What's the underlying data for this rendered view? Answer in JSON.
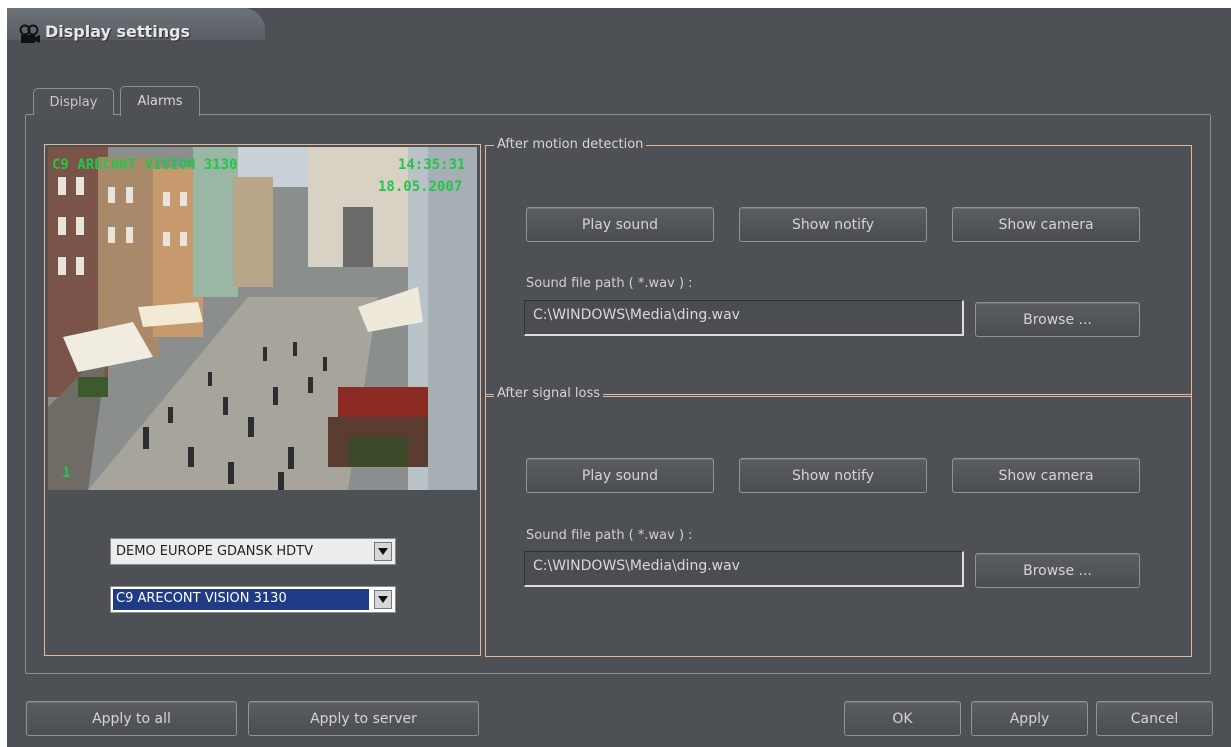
{
  "window": {
    "title": "Display settings"
  },
  "tabs": [
    {
      "label": "Display",
      "active": false
    },
    {
      "label": "Alarms",
      "active": true
    }
  ],
  "camera": {
    "overlay_name": "C9 ARECONT VISION 3130",
    "overlay_time": "14:35:31",
    "overlay_date": "18.05.2007",
    "overlay_index": "1"
  },
  "selectors": {
    "server": "DEMO EUROPE GDANSK HDTV",
    "camera": "C9 ARECONT VISION 3130"
  },
  "motion": {
    "title": "After motion detection",
    "play_sound": "Play sound",
    "show_notify": "Show notify",
    "show_camera": "Show camera",
    "path_label": "Sound file path ( *.wav ) :",
    "path_value": "C:\\WINDOWS\\Media\\ding.wav",
    "browse": "Browse ..."
  },
  "signal": {
    "title": "After signal loss",
    "play_sound": "Play sound",
    "show_notify": "Show notify",
    "show_camera": "Show camera",
    "path_label": "Sound file path ( *.wav ) :",
    "path_value": "C:\\WINDOWS\\Media\\ding.wav",
    "browse": "Browse ..."
  },
  "footer": {
    "apply_all": "Apply to all",
    "apply_server": "Apply to server",
    "ok": "OK",
    "apply": "Apply",
    "cancel": "Cancel"
  },
  "colors": {
    "background": "#4d5155",
    "group_border": "#e2b79c",
    "overlay_text": "#23c64a",
    "selected_item": "#1f3b86"
  }
}
